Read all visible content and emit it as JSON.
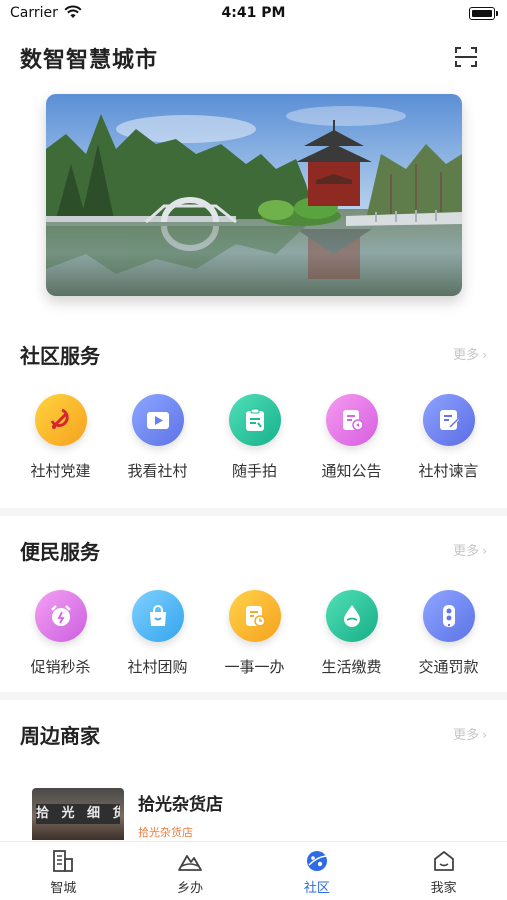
{
  "status_bar": {
    "carrier": "Carrier",
    "time": "4:41 PM"
  },
  "header": {
    "title": "数智智慧城市",
    "scan_icon": "scan-icon"
  },
  "banner": {
    "image": "pavilion-lake-photo"
  },
  "community_services": {
    "title": "社区服务",
    "more": "更多",
    "items": [
      {
        "label": "社村党建",
        "icon": "party-emblem-icon",
        "color": "#f8b62c"
      },
      {
        "label": "我看社村",
        "icon": "video-play-icon",
        "color": "#6f86ec"
      },
      {
        "label": "随手拍",
        "icon": "clipboard-photo-icon",
        "color": "#28c49c"
      },
      {
        "label": "通知公告",
        "icon": "notice-icon",
        "color": "#e873e0"
      },
      {
        "label": "社村谏言",
        "icon": "suggestion-note-icon",
        "color": "#6a7ff0"
      }
    ]
  },
  "convenience_services": {
    "title": "便民服务",
    "more": "更多",
    "items": [
      {
        "label": "促销秒杀",
        "icon": "alarm-clock-icon",
        "color": "#e070e4"
      },
      {
        "label": "社村团购",
        "icon": "shopping-bag-icon",
        "color": "#4fb9f2"
      },
      {
        "label": "一事一办",
        "icon": "document-clock-icon",
        "color": "#f8b62c"
      },
      {
        "label": "生活缴费",
        "icon": "water-drop-icon",
        "color": "#26c3a0"
      },
      {
        "label": "交通罚款",
        "icon": "traffic-light-icon",
        "color": "#6f86ec"
      }
    ]
  },
  "nearby_merchants": {
    "title": "周边商家",
    "more": "更多",
    "items": [
      {
        "name": "拾光杂货店",
        "tag": "拾光杂货店",
        "sign": "拾 光 细 货"
      }
    ]
  },
  "tabbar": {
    "items": [
      {
        "label": "智城",
        "icon": "building-icon",
        "active": false
      },
      {
        "label": "乡办",
        "icon": "mountain-icon",
        "active": false
      },
      {
        "label": "社区",
        "icon": "planet-icon",
        "active": true
      },
      {
        "label": "我家",
        "icon": "home-icon",
        "active": false
      }
    ],
    "active_color": "#2e6be6"
  }
}
